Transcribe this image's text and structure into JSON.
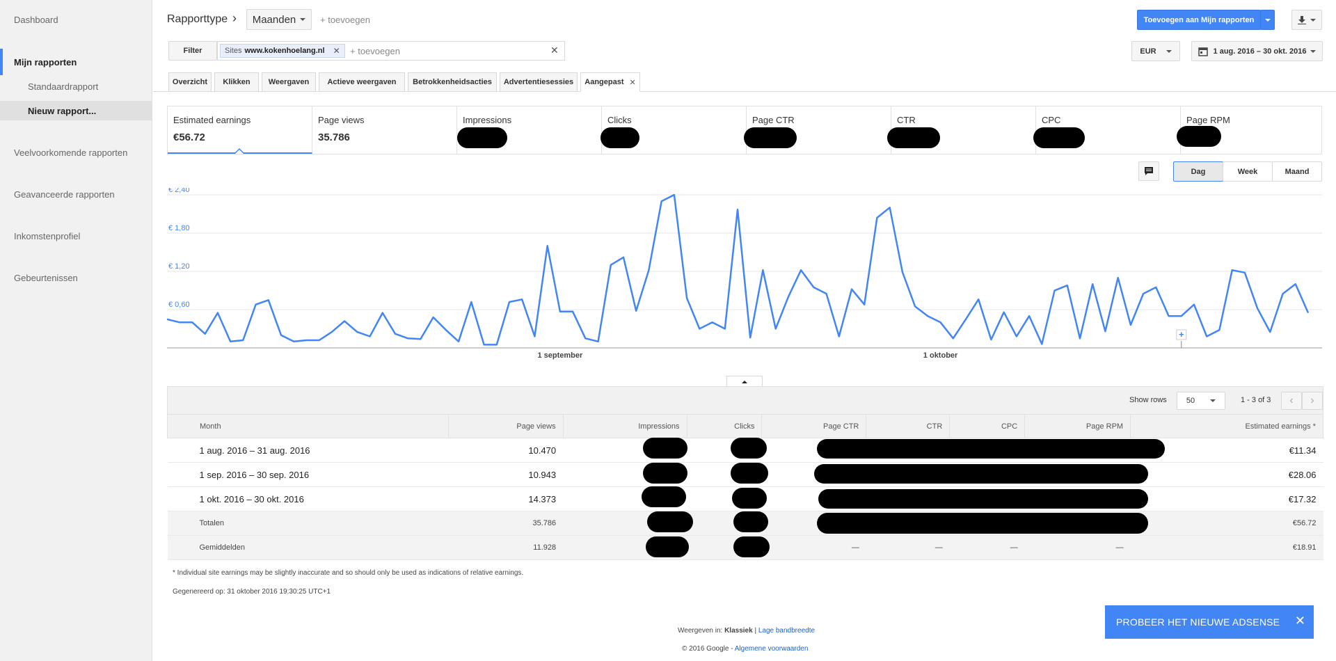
{
  "sidebar": {
    "dashboard": "Dashboard",
    "mijn_rapporten": "Mijn rapporten",
    "standaardrapport": "Standaardrapport",
    "nieuw_rapport": "Nieuw rapport...",
    "veelvoorkomende": "Veelvoorkomende rapporten",
    "geavanceerde": "Geavanceerde rapporten",
    "inkomstenprofiel": "Inkomstenprofiel",
    "gebeurtenissen": "Gebeurtenissen"
  },
  "header": {
    "rapporttype": "Rapporttype",
    "chevron": "›",
    "period_select": "Maanden",
    "add_dimension": "+ toevoegen",
    "add_to_reports": "Toevoegen aan Mijn rapporten",
    "download_icon": "download-icon"
  },
  "filter": {
    "filter_button": "Filter",
    "chip_prefix": "Sites",
    "chip_value": "www.kokenhoelang.nl",
    "placeholder": "+ toevoegen",
    "currency": "EUR",
    "date_range": "1 aug. 2016 – 30 okt. 2016"
  },
  "tabs": [
    "Overzicht",
    "Klikken",
    "Weergaven",
    "Actieve weergaven",
    "Betrokkenheidsacties",
    "Advertentiesessies",
    "Aangepast"
  ],
  "metrics": [
    {
      "label": "Estimated earnings",
      "value": "€56.72"
    },
    {
      "label": "Page views",
      "value": "35.786"
    },
    {
      "label": "Impressions",
      "value": ""
    },
    {
      "label": "Clicks",
      "value": ""
    },
    {
      "label": "Page CTR",
      "value": ""
    },
    {
      "label": "CTR",
      "value": ""
    },
    {
      "label": "CPC",
      "value": ""
    },
    {
      "label": "Page RPM",
      "value": ""
    }
  ],
  "granularity": {
    "day": "Dag",
    "week": "Week",
    "month": "Maand"
  },
  "chart_data": {
    "type": "line",
    "title": "",
    "xlabel": "",
    "ylabel": "",
    "ylim": [
      0,
      2.4
    ],
    "ytick_labels": [
      "€ 0,60",
      "€ 1,20",
      "€ 1,80",
      "€ 2,40"
    ],
    "xtick_labels": [
      "1 september",
      "1 oktober"
    ],
    "grid": true,
    "series": [
      {
        "name": "",
        "values": [
          0.45,
          0.4,
          0.4,
          0.22,
          0.55,
          0.1,
          0.12,
          0.68,
          0.75,
          0.2,
          0.1,
          0.12,
          0.12,
          0.25,
          0.42,
          0.25,
          0.18,
          0.55,
          0.22,
          0.15,
          0.14,
          0.48,
          0.28,
          0.1,
          0.72,
          0.05,
          0.05,
          0.72,
          0.76,
          0.18,
          1.6,
          0.57,
          0.57,
          0.15,
          0.1,
          1.3,
          1.42,
          0.58,
          1.22,
          2.3,
          2.4,
          0.78,
          0.3,
          0.4,
          0.3,
          2.17,
          0.16,
          1.22,
          0.3,
          0.8,
          1.22,
          0.95,
          0.85,
          0.18,
          0.92,
          0.68,
          2.04,
          2.2,
          1.19,
          0.65,
          0.5,
          0.4,
          0.15,
          0.45,
          0.76,
          0.13,
          0.56,
          0.18,
          0.5,
          0.06,
          0.9,
          0.98,
          0.15,
          1.0,
          0.26,
          1.1,
          0.36,
          0.85,
          0.95,
          0.5,
          0.5,
          0.68,
          0.18,
          0.28,
          1.22,
          1.18,
          0.62,
          0.25,
          0.85,
          1.0,
          0.55
        ]
      }
    ]
  },
  "table": {
    "show_rows_label": "Show rows",
    "rows_value": "50",
    "range": "1 - 3 of 3",
    "columns": [
      "Month",
      "Page views",
      "Impressions",
      "Clicks",
      "Page CTR",
      "CTR",
      "CPC",
      "Page RPM",
      "Estimated earnings *"
    ],
    "rows": [
      {
        "month": "1 aug. 2016 – 31 aug. 2016",
        "page_views": "10.470",
        "earnings": "€11.34"
      },
      {
        "month": "1 sep. 2016 – 30 sep. 2016",
        "page_views": "10.943",
        "earnings": "€28.06"
      },
      {
        "month": "1 okt. 2016 – 30 okt. 2016",
        "page_views": "14.373",
        "earnings": "€17.32"
      }
    ],
    "totals": {
      "label": "Totalen",
      "page_views": "35.786",
      "earnings": "€56.72"
    },
    "averages": {
      "label": "Gemiddelden",
      "page_views": "11.928",
      "dash": "—",
      "earnings": "€18.91"
    }
  },
  "footer": {
    "note": "* Individual site earnings may be slightly inaccurate and so should only be used as indications of relative earnings.",
    "generated": "Gegenereerd op: 31 oktober 2016 19:30:25 UTC+1",
    "view_in": "Weergeven in:",
    "klassiek": "Klassiek",
    "separator": "|",
    "lage_bandbreedte": "Lage bandbreedte",
    "copyright": "© 2016 Google -",
    "terms": "Algemene voorwaarden",
    "try_new": "PROBEER HET NIEUWE ADSENSE",
    "close_glyph": "✕"
  },
  "colors": {
    "accent": "#4285f4",
    "line": "#4285f4"
  }
}
